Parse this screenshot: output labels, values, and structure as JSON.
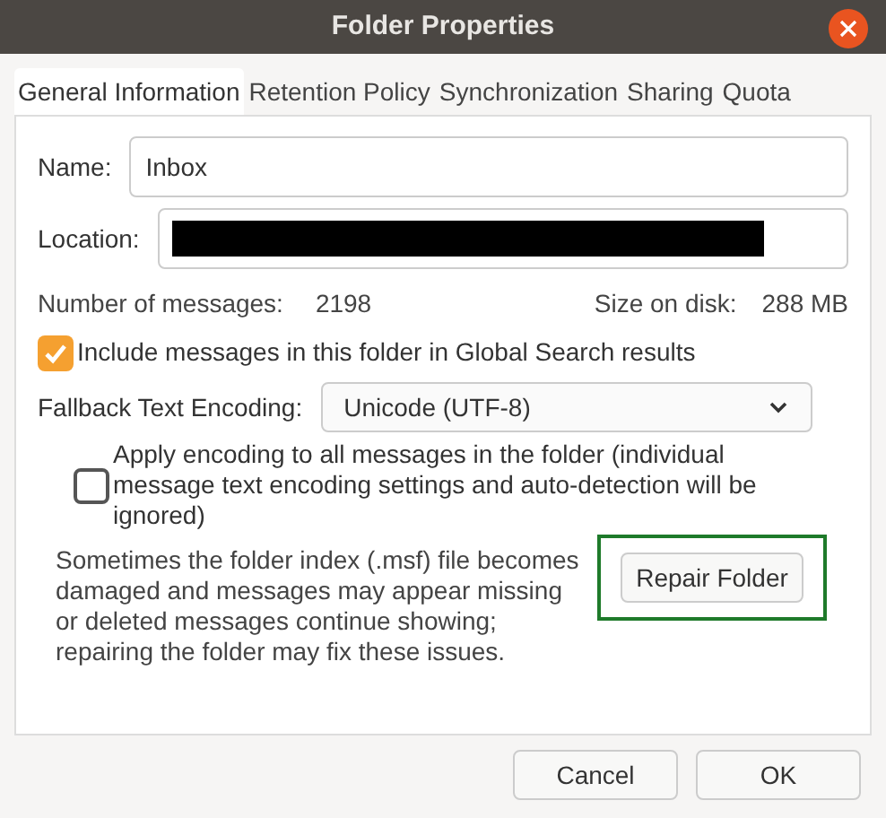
{
  "window": {
    "title": "Folder Properties"
  },
  "tabs": [
    {
      "label": "General Information",
      "selected": true
    },
    {
      "label": "Retention Policy",
      "selected": false
    },
    {
      "label": "Synchronization",
      "selected": false
    },
    {
      "label": "Sharing",
      "selected": false
    },
    {
      "label": "Quota",
      "selected": false
    }
  ],
  "name_field": {
    "label": "Name:",
    "value": "Inbox"
  },
  "location_field": {
    "label": "Location:",
    "redacted": true
  },
  "stats": {
    "messages_label": "Number of messages:",
    "messages_value": "2198",
    "size_label": "Size on disk:",
    "size_value": "288 MB"
  },
  "global_search": {
    "label": "Include messages in this folder in Global Search results",
    "checked": true
  },
  "encoding": {
    "label": "Fallback Text Encoding:",
    "value": "Unicode (UTF-8)"
  },
  "apply_encoding": {
    "label": "Apply encoding to all messages in the folder (individual message text encoding settings and auto-detection will be ignored)",
    "checked": false
  },
  "repair": {
    "text": "Sometimes the folder index (.msf) file becomes damaged and messages may appear missing or deleted messages continue showing; repairing the folder may fix these issues.",
    "button": "Repair Folder",
    "highlighted": true
  },
  "buttons": [
    "Cancel",
    "OK"
  ]
}
